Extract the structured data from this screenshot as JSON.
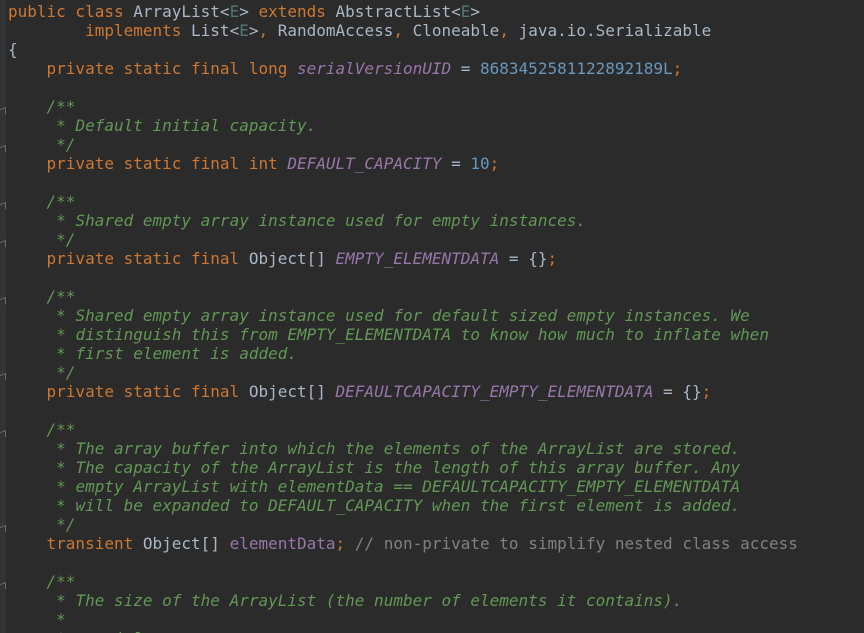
{
  "lines": [
    [
      {
        "c": "kw",
        "t": "public class "
      },
      {
        "c": "pl",
        "t": "ArrayList<"
      },
      {
        "c": "tp",
        "t": "E"
      },
      {
        "c": "pl",
        "t": "> "
      },
      {
        "c": "kw",
        "t": "extends "
      },
      {
        "c": "pl",
        "t": "AbstractList<"
      },
      {
        "c": "tp",
        "t": "E"
      },
      {
        "c": "pl",
        "t": ">"
      }
    ],
    [
      {
        "c": "pl",
        "t": "        "
      },
      {
        "c": "kw",
        "t": "implements "
      },
      {
        "c": "pl",
        "t": "List<"
      },
      {
        "c": "tp",
        "t": "E"
      },
      {
        "c": "pl",
        "t": ">"
      },
      {
        "c": "kw",
        "t": ", "
      },
      {
        "c": "pl",
        "t": "RandomAccess"
      },
      {
        "c": "kw",
        "t": ", "
      },
      {
        "c": "pl",
        "t": "Cloneable"
      },
      {
        "c": "kw",
        "t": ", "
      },
      {
        "c": "pl",
        "t": "java.io.Serializable"
      }
    ],
    [
      {
        "c": "pl",
        "t": "{"
      }
    ],
    [
      {
        "c": "pl",
        "t": "    "
      },
      {
        "c": "kw",
        "t": "private static final long "
      },
      {
        "c": "sf",
        "t": "serialVersionUID"
      },
      {
        "c": "pl",
        "t": " = "
      },
      {
        "c": "num",
        "t": "8683452581122892189L"
      },
      {
        "c": "kw",
        "t": ";"
      }
    ],
    [],
    [
      {
        "c": "pl",
        "t": "    "
      },
      {
        "c": "doc",
        "t": "/**"
      }
    ],
    [
      {
        "c": "pl",
        "t": "     "
      },
      {
        "c": "doc",
        "t": "* Default initial capacity."
      }
    ],
    [
      {
        "c": "pl",
        "t": "     "
      },
      {
        "c": "doc",
        "t": "*/"
      }
    ],
    [
      {
        "c": "pl",
        "t": "    "
      },
      {
        "c": "kw",
        "t": "private static final int "
      },
      {
        "c": "sf",
        "t": "DEFAULT_CAPACITY"
      },
      {
        "c": "pl",
        "t": " = "
      },
      {
        "c": "num",
        "t": "10"
      },
      {
        "c": "kw",
        "t": ";"
      }
    ],
    [],
    [
      {
        "c": "pl",
        "t": "    "
      },
      {
        "c": "doc",
        "t": "/**"
      }
    ],
    [
      {
        "c": "pl",
        "t": "     "
      },
      {
        "c": "doc",
        "t": "* Shared empty array instance used for empty instances."
      }
    ],
    [
      {
        "c": "pl",
        "t": "     "
      },
      {
        "c": "doc",
        "t": "*/"
      }
    ],
    [
      {
        "c": "pl",
        "t": "    "
      },
      {
        "c": "kw",
        "t": "private static final "
      },
      {
        "c": "pl",
        "t": "Object[] "
      },
      {
        "c": "sf",
        "t": "EMPTY_ELEMENTDATA"
      },
      {
        "c": "pl",
        "t": " = {}"
      },
      {
        "c": "kw",
        "t": ";"
      }
    ],
    [],
    [
      {
        "c": "pl",
        "t": "    "
      },
      {
        "c": "doc",
        "t": "/**"
      }
    ],
    [
      {
        "c": "pl",
        "t": "     "
      },
      {
        "c": "doc",
        "t": "* Shared empty array instance used for default sized empty instances. We"
      }
    ],
    [
      {
        "c": "pl",
        "t": "     "
      },
      {
        "c": "doc",
        "t": "* distinguish this from EMPTY_ELEMENTDATA to know how much to inflate when"
      }
    ],
    [
      {
        "c": "pl",
        "t": "     "
      },
      {
        "c": "doc",
        "t": "* first element is added."
      }
    ],
    [
      {
        "c": "pl",
        "t": "     "
      },
      {
        "c": "doc",
        "t": "*/"
      }
    ],
    [
      {
        "c": "pl",
        "t": "    "
      },
      {
        "c": "kw",
        "t": "private static final "
      },
      {
        "c": "pl",
        "t": "Object[] "
      },
      {
        "c": "sf",
        "t": "DEFAULTCAPACITY_EMPTY_ELEMENTDATA"
      },
      {
        "c": "pl",
        "t": " = {}"
      },
      {
        "c": "kw",
        "t": ";"
      }
    ],
    [],
    [
      {
        "c": "pl",
        "t": "    "
      },
      {
        "c": "doc",
        "t": "/**"
      }
    ],
    [
      {
        "c": "pl",
        "t": "     "
      },
      {
        "c": "doc",
        "t": "* The array buffer into which the elements of the ArrayList are stored."
      }
    ],
    [
      {
        "c": "pl",
        "t": "     "
      },
      {
        "c": "doc",
        "t": "* The capacity of the ArrayList is the length of this array buffer. Any"
      }
    ],
    [
      {
        "c": "pl",
        "t": "     "
      },
      {
        "c": "doc",
        "t": "* empty ArrayList with elementData == DEFAULTCAPACITY_EMPTY_ELEMENTDATA"
      }
    ],
    [
      {
        "c": "pl",
        "t": "     "
      },
      {
        "c": "doc",
        "t": "* will be expanded to DEFAULT_CAPACITY when the first element is added."
      }
    ],
    [
      {
        "c": "pl",
        "t": "     "
      },
      {
        "c": "doc",
        "t": "*/"
      }
    ],
    [
      {
        "c": "pl",
        "t": "    "
      },
      {
        "c": "kw",
        "t": "transient "
      },
      {
        "c": "pl",
        "t": "Object[] "
      },
      {
        "c": "fld",
        "t": "elementData"
      },
      {
        "c": "kw",
        "t": "; "
      },
      {
        "c": "cmt",
        "t": "// non-private to simplify nested class access"
      }
    ],
    [],
    [
      {
        "c": "pl",
        "t": "    "
      },
      {
        "c": "doc",
        "t": "/**"
      }
    ],
    [
      {
        "c": "pl",
        "t": "     "
      },
      {
        "c": "doc",
        "t": "* The size of the ArrayList (the number of elements it contains)."
      }
    ],
    [
      {
        "c": "pl",
        "t": "     "
      },
      {
        "c": "doc",
        "t": "*"
      }
    ],
    [
      {
        "c": "pl",
        "t": "     "
      },
      {
        "c": "doc",
        "t": "* @serial"
      }
    ]
  ],
  "colors": {
    "background": "#2b2b2b",
    "keyword": "#cc7832",
    "plain": "#a9b7c6",
    "type_param": "#507874",
    "number": "#6897bb",
    "doc_comment": "#629755",
    "line_comment": "#808080",
    "static_field": "#9876aa"
  }
}
